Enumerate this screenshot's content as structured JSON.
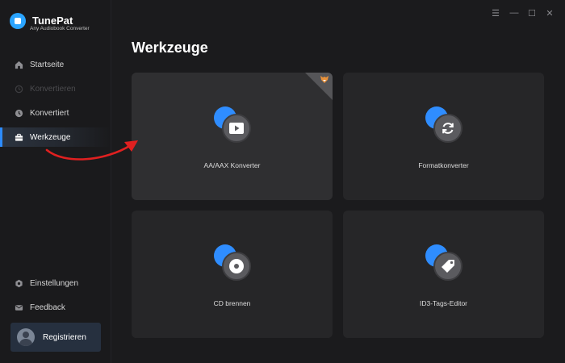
{
  "app": {
    "name": "TunePat",
    "subtitle": "Any Audiobook Converter"
  },
  "window_controls": {
    "menu": "☰",
    "minimize": "—",
    "maximize": "☐",
    "close": "✕"
  },
  "sidebar": {
    "items": [
      {
        "label": "Startseite",
        "icon": "home-icon",
        "state": "normal"
      },
      {
        "label": "Konvertieren",
        "icon": "convert-icon",
        "state": "disabled"
      },
      {
        "label": "Konvertiert",
        "icon": "clock-icon",
        "state": "normal"
      },
      {
        "label": "Werkzeuge",
        "icon": "toolbox-icon",
        "state": "active"
      }
    ],
    "bottom_items": [
      {
        "label": "Einstellungen",
        "icon": "gear-icon"
      },
      {
        "label": "Feedback",
        "icon": "mail-icon"
      }
    ],
    "register_label": "Registrieren"
  },
  "main": {
    "title": "Werkzeuge",
    "tools": [
      {
        "label": "AA/AAX Konverter",
        "icon": "play-icon",
        "highlighted": true,
        "badge": "pro-badge"
      },
      {
        "label": "Formatkonverter",
        "icon": "refresh-icon"
      },
      {
        "label": "CD brennen",
        "icon": "disc-icon"
      },
      {
        "label": "ID3-Tags-Editor",
        "icon": "tag-icon"
      }
    ]
  },
  "colors": {
    "accent": "#2d8cff",
    "annotation_arrow": "#e02020",
    "background": "#1b1b1d",
    "card": "#262628"
  }
}
